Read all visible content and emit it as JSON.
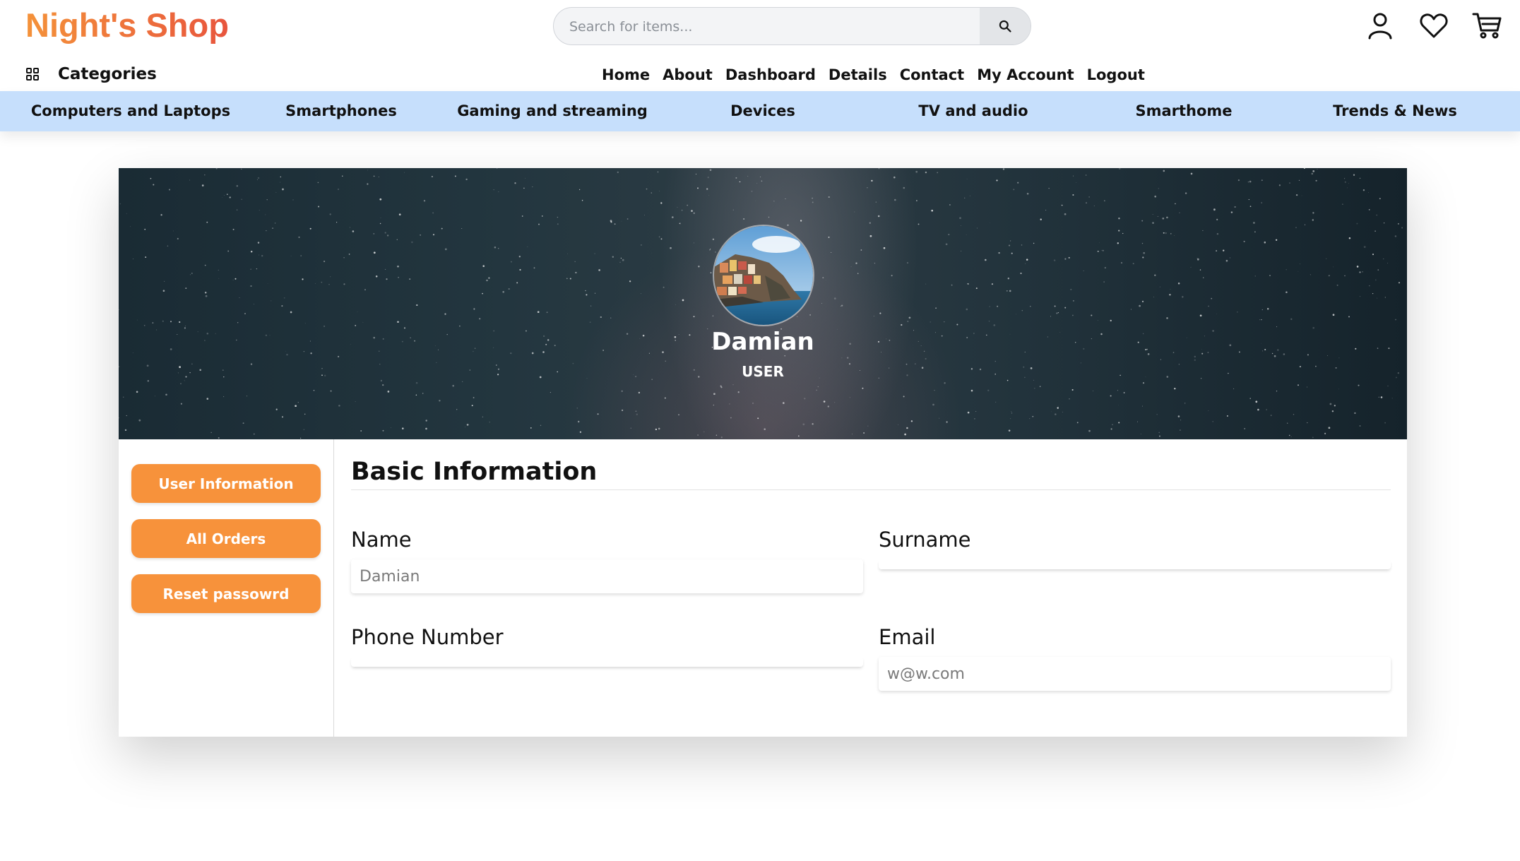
{
  "header": {
    "logo": "Night's Shop",
    "search_placeholder": "Search for items...",
    "icons": [
      "search-icon",
      "user-icon",
      "heart-icon",
      "cart-icon"
    ]
  },
  "nav": {
    "categories_label": "Categories",
    "links": [
      "Home",
      "About",
      "Dashboard",
      "Details",
      "Contact",
      "My Account",
      "Logout"
    ]
  },
  "category_bar": {
    "items": [
      "Computers and Laptops",
      "Smartphones",
      "Gaming and streaming",
      "Devices",
      "TV and audio",
      "Smarthome",
      "Trends & News"
    ]
  },
  "profile": {
    "name": "Damian",
    "role": "USER"
  },
  "sidebar": {
    "buttons": [
      "User Information",
      "All Orders",
      "Reset passowrd"
    ]
  },
  "form": {
    "title": "Basic Information",
    "name_label": "Name",
    "name_placeholder": "Damian",
    "surname_label": "Surname",
    "surname_value": "",
    "phone_label": "Phone Number",
    "phone_value": "",
    "email_label": "Email",
    "email_placeholder": "w@w.com"
  },
  "colors": {
    "accent": "#f7923b",
    "logo_gradient_start": "#f4923a",
    "logo_gradient_end": "#e8553d",
    "category_bar": "#c6dffc"
  }
}
